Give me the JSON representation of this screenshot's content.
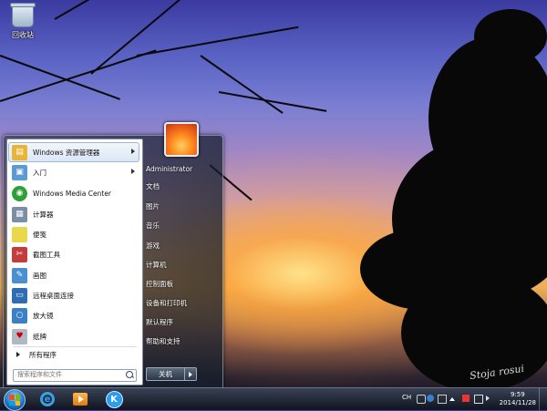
{
  "desktop": {
    "icons": [
      {
        "label": "回收站",
        "icon": "recycle-bin-icon"
      }
    ],
    "watermark": "Stoja rosui"
  },
  "start_menu": {
    "pinned": [
      {
        "label": "Windows 资源管理器",
        "icon": "explorer-icon",
        "color": "#e9b43a",
        "arrow": true
      },
      {
        "label": "入门",
        "icon": "getting-started-icon",
        "color": "#5a9bd5",
        "arrow": true
      },
      {
        "label": "Windows Media Center",
        "icon": "media-center-icon",
        "color": "#2f9f3a",
        "arrow": false
      },
      {
        "label": "计算器",
        "icon": "calculator-icon",
        "color": "#7a8fa6",
        "arrow": false
      },
      {
        "label": "便笺",
        "icon": "sticky-notes-icon",
        "color": "#e8d84a",
        "arrow": false
      },
      {
        "label": "截图工具",
        "icon": "snipping-tool-icon",
        "color": "#c43d3d",
        "arrow": false
      },
      {
        "label": "画图",
        "icon": "paint-icon",
        "color": "#4a8fd1",
        "arrow": false
      },
      {
        "label": "远程桌面连接",
        "icon": "remote-desktop-icon",
        "color": "#2e6db4",
        "arrow": false
      },
      {
        "label": "放大镜",
        "icon": "magnifier-icon",
        "color": "#3b7fc8",
        "arrow": false
      },
      {
        "label": "纸牌",
        "icon": "solitaire-icon",
        "color": "#b0b8c4",
        "arrow": false
      }
    ],
    "all_programs": "所有程序",
    "search_placeholder": "搜索程序和文件",
    "user": "Administrator",
    "right_links": [
      "文档",
      "图片",
      "音乐",
      "游戏",
      "计算机",
      "控制面板",
      "设备和打印机",
      "默认程序",
      "帮助和支持"
    ],
    "shutdown": "关机"
  },
  "taskbar": {
    "apps": [
      {
        "name": "internet-explorer",
        "icon": "ie-icon"
      },
      {
        "name": "media-player",
        "icon": "media-player-icon"
      },
      {
        "name": "k-app",
        "icon": "k-app-icon",
        "letter": "K"
      }
    ],
    "language": "CH",
    "time": "9:59",
    "date": "2014/11/28"
  }
}
